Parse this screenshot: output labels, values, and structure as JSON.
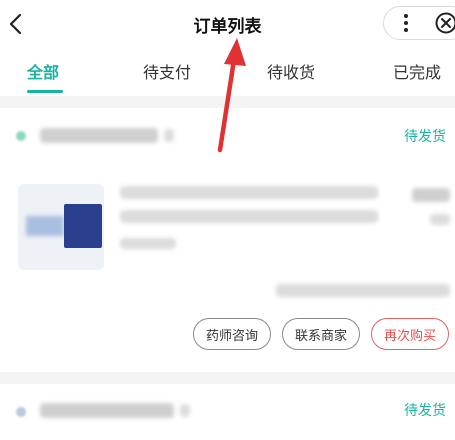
{
  "header": {
    "title": "订单列表"
  },
  "tabs": [
    {
      "label": "全部",
      "active": true
    },
    {
      "label": "待支付",
      "active": false
    },
    {
      "label": "待收货",
      "active": false
    },
    {
      "label": "已完成",
      "active": false
    }
  ],
  "orders": [
    {
      "status": "待发货",
      "actions": [
        "药师咨询",
        "联系商家",
        "再次购买"
      ]
    },
    {
      "status": "待发货"
    }
  ],
  "colors": {
    "accent": "#1ab3a0",
    "buy_again": "#e05050",
    "arrow": "#e03232"
  },
  "icons": {
    "back": "chevron-left-icon",
    "more": "more-vertical-icon",
    "close": "close-circle-icon"
  }
}
